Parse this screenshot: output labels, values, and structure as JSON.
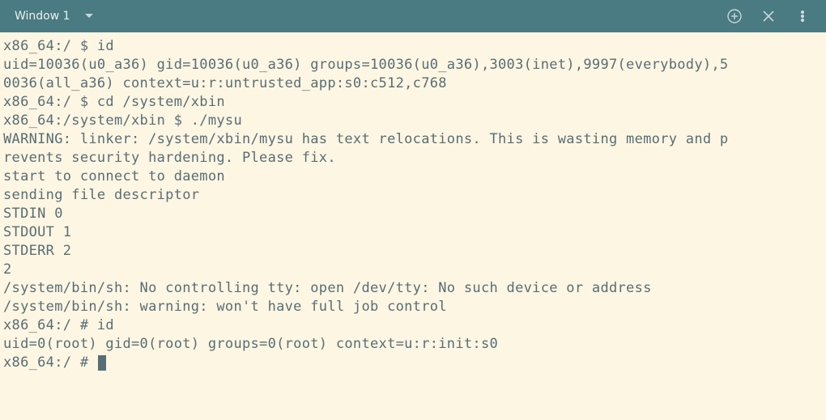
{
  "titlebar": {
    "title": "Window 1"
  },
  "terminal": {
    "lines": [
      "x86_64:/ $ id",
      "uid=10036(u0_a36) gid=10036(u0_a36) groups=10036(u0_a36),3003(inet),9997(everybody),5",
      "0036(all_a36) context=u:r:untrusted_app:s0:c512,c768",
      "x86_64:/ $ cd /system/xbin",
      "x86_64:/system/xbin $ ./mysu",
      "WARNING: linker: /system/xbin/mysu has text relocations. This is wasting memory and p",
      "revents security hardening. Please fix.",
      "start to connect to daemon",
      "sending file descriptor",
      "STDIN 0",
      "STDOUT 1",
      "STDERR 2",
      "2",
      "/system/bin/sh: No controlling tty: open /dev/tty: No such device or address",
      "/system/bin/sh: warning: won't have full job control",
      "x86_64:/ # id",
      "uid=0(root) gid=0(root) groups=0(root) context=u:r:init:s0",
      "x86_64:/ # "
    ]
  }
}
